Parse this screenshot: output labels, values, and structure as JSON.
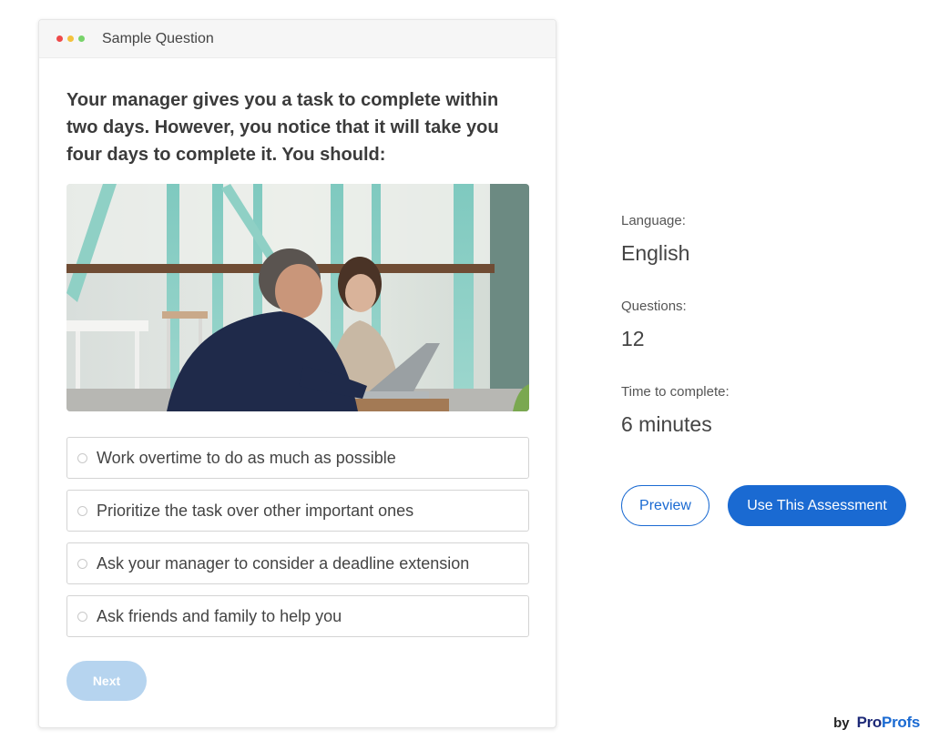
{
  "card": {
    "header_title": "Sample Question",
    "window_dot_colors": [
      "#ee4a4a",
      "#f4c23d",
      "#78d36a"
    ],
    "question": "Your manager gives you a task to complete within two days. However, you notice that it will take you four days to complete it. You should:",
    "image": {
      "alt": "Two colleagues discussing work at a laptop in a cafe"
    },
    "options": [
      {
        "label": "Work overtime to do as much as possible"
      },
      {
        "label": "Prioritize the task over other important ones"
      },
      {
        "label": "Ask your manager to consider a deadline extension"
      },
      {
        "label": "Ask friends and family to help you"
      }
    ],
    "next_label": "Next"
  },
  "info": {
    "language_label": "Language:",
    "language_value": "English",
    "questions_label": "Questions:",
    "questions_value": "12",
    "time_label": "Time to complete:",
    "time_value": "6 minutes"
  },
  "actions": {
    "preview_label": "Preview",
    "use_label": "Use This Assessment"
  },
  "brand": {
    "by": "by",
    "logo_part1": "Pro",
    "logo_part2": "Profs"
  },
  "colors": {
    "accent": "#1a6ad2",
    "next_disabled": "#b6d4ef"
  }
}
